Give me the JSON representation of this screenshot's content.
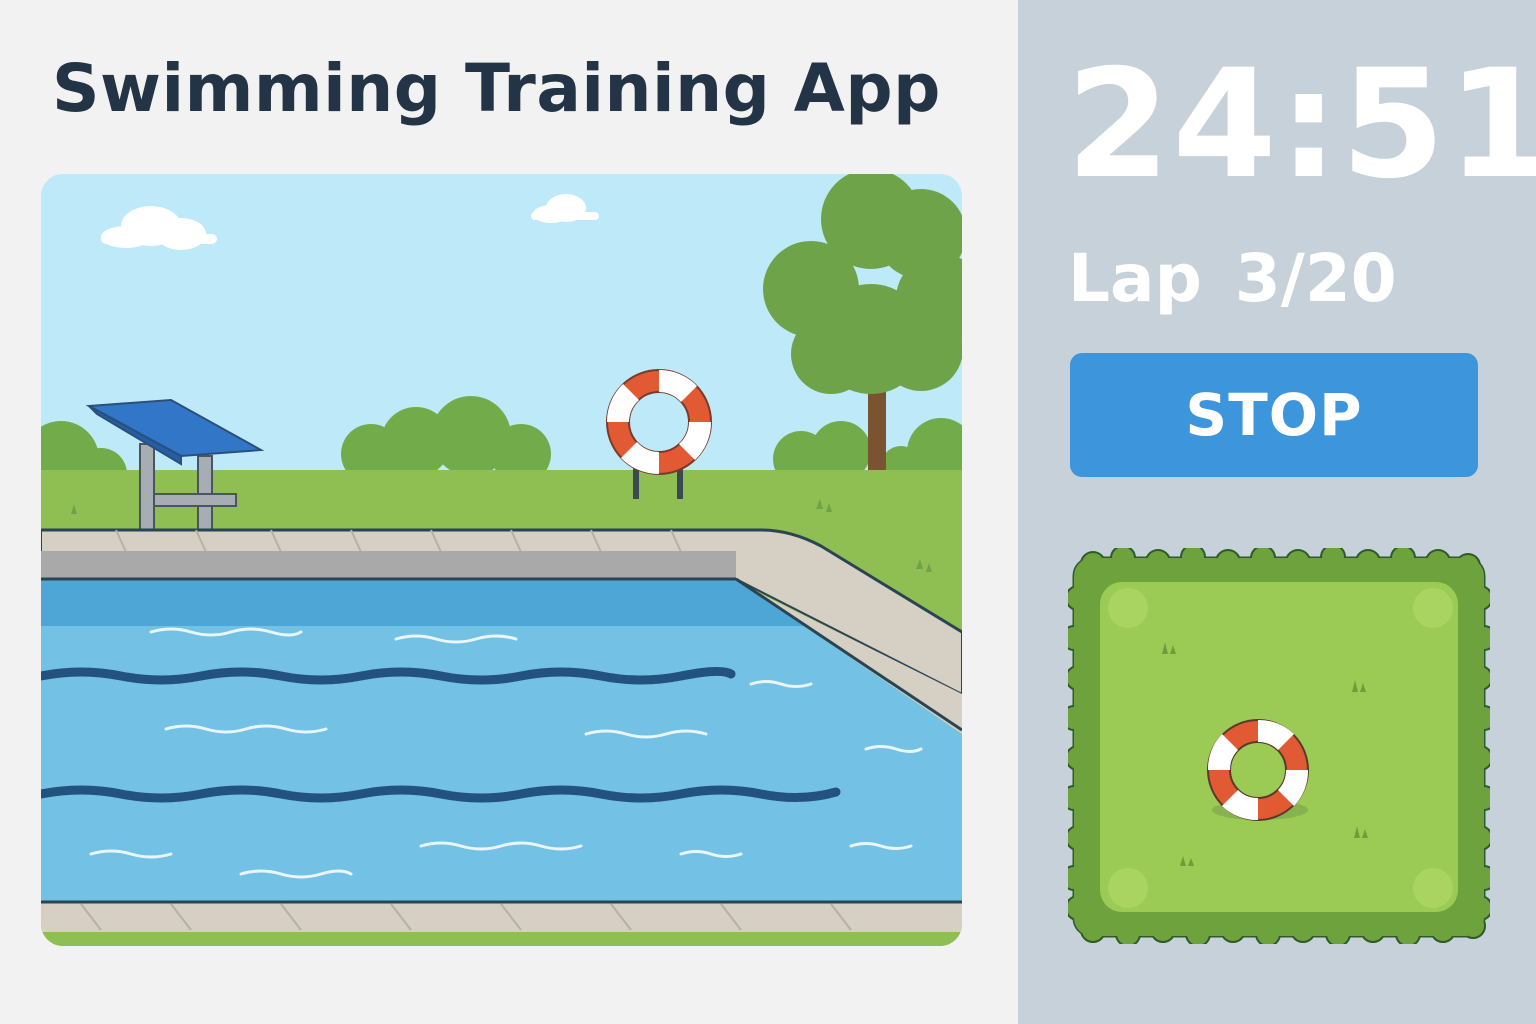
{
  "app": {
    "title": "Swimming Training App"
  },
  "workout": {
    "timer": "24:51",
    "lap_label": "Lap 3/20",
    "current_lap": 3,
    "total_laps": 20
  },
  "controls": {
    "stop_label": "STOP"
  },
  "scene": {
    "elements": [
      "diving-board",
      "lifebuoy",
      "tree",
      "pool",
      "lane-ropes",
      "clouds",
      "bushes"
    ]
  },
  "minimap": {
    "icon": "lifebuoy-icon"
  },
  "colors": {
    "title": "#243447",
    "side_panel": "#c7d1da",
    "stop_button": "#3d95dc",
    "water": "#74c1e6",
    "grass": "#8fbf53",
    "sky": "#bde9f8"
  }
}
